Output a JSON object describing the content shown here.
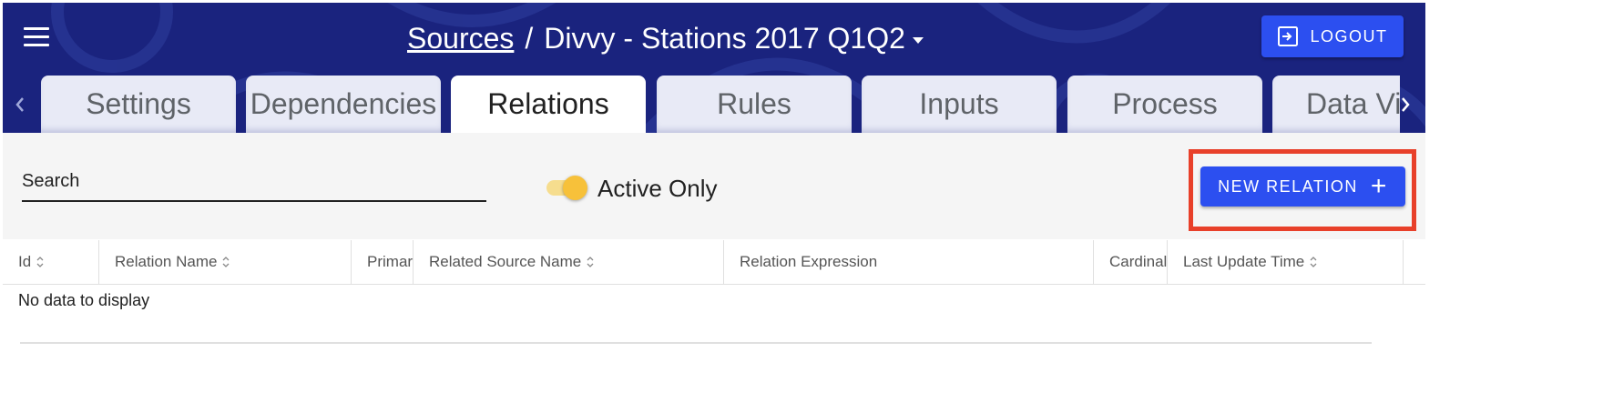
{
  "header": {
    "breadcrumb": {
      "root": "Sources",
      "separator": "/",
      "current": "Divvy - Stations 2017 Q1Q2"
    },
    "logout_label": "LOGOUT"
  },
  "tabs": [
    {
      "label": "Settings",
      "active": false
    },
    {
      "label": "Dependencies",
      "active": false
    },
    {
      "label": "Relations",
      "active": true
    },
    {
      "label": "Rules",
      "active": false
    },
    {
      "label": "Inputs",
      "active": false
    },
    {
      "label": "Process",
      "active": false
    },
    {
      "label": "Data Viewer",
      "active": false
    }
  ],
  "toolbar": {
    "search_placeholder": "Search",
    "search_value": "",
    "active_only_label": "Active Only",
    "active_only_checked": true,
    "new_relation_label": "NEW RELATION",
    "new_relation_icon": "plus-icon"
  },
  "table": {
    "columns": [
      {
        "label": "Id",
        "sortable": true
      },
      {
        "label": "Relation Name",
        "sortable": true
      },
      {
        "label": "Primary",
        "sortable": false
      },
      {
        "label": "Related Source Name",
        "sortable": true
      },
      {
        "label": "Relation Expression",
        "sortable": false
      },
      {
        "label": "Cardinality",
        "sortable": false
      },
      {
        "label": "Last Update Time",
        "sortable": true
      }
    ],
    "empty_message": "No data to display"
  },
  "colors": {
    "header_bg": "#1a237e",
    "button_bg": "#2c4ff0",
    "toggle_on": "#f7c13a",
    "highlight_border": "#e8402a",
    "toolbar_bg": "#f5f5f5",
    "tab_inactive_bg": "#e8eaf6"
  }
}
